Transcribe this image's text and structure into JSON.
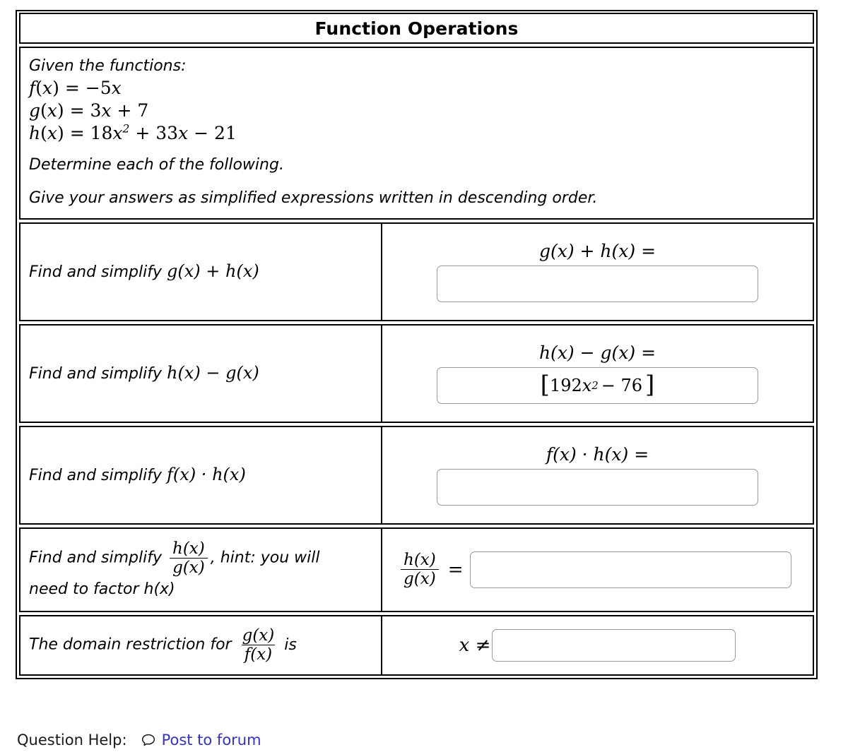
{
  "header": {
    "title": "Function Operations"
  },
  "prompt": {
    "given_label": "Given the functions:",
    "functions": [
      {
        "name": "f",
        "body": "= -5x"
      },
      {
        "name": "g",
        "body": "= 3x + 7"
      },
      {
        "name": "h",
        "body": "= 18x^2 + 33x - 21"
      }
    ],
    "instruction_1": "Determine each of the following.",
    "instruction_2": "Give your answers as simplified expressions written in descending order."
  },
  "rows": [
    {
      "id": "sum",
      "prompt_prefix": "Find and simplify ",
      "prompt_math": "g(x) + h(x)",
      "expr_head": "g(x) + h(x) =",
      "answer_value": "",
      "answer_placeholder": ""
    },
    {
      "id": "difference",
      "prompt_prefix": "Find and simplify ",
      "prompt_math": "h(x) − g(x)",
      "expr_head": "h(x) − g(x) =",
      "answer_value": "192x^2 − 76",
      "answer_open_bracket": "[",
      "answer_close_bracket": "]",
      "answer_coefficient": "192",
      "answer_variable": "x",
      "answer_exponent": "2",
      "answer_tail": "− 76",
      "answer_placeholder": ""
    },
    {
      "id": "product",
      "prompt_prefix": "Find and simplify ",
      "prompt_math": "f(x) · h(x)",
      "expr_head": "f(x) · h(x) =",
      "answer_value": "",
      "answer_placeholder": ""
    },
    {
      "id": "quotient",
      "prompt_prefix": "Find and simplify ",
      "prompt_frac_num": "h(x)",
      "prompt_frac_den": "g(x)",
      "prompt_suffix": ", hint: you will",
      "prompt_line2": "need to factor h(x)",
      "expr_frac_num": "h(x)",
      "expr_frac_den": "g(x)",
      "equals": "=",
      "answer_value": "",
      "answer_placeholder": ""
    },
    {
      "id": "domain",
      "prompt_prefix": "The domain restriction for ",
      "prompt_frac_num": "g(x)",
      "prompt_frac_den": "f(x)",
      "prompt_suffix": "is",
      "not_equal": "x ≠",
      "answer_value": "",
      "answer_placeholder": ""
    }
  ],
  "footer": {
    "help_label": "Question Help:",
    "forum_link": "Post to forum",
    "icon": "speech-bubble-icon",
    "link_color": "#3333bb"
  }
}
